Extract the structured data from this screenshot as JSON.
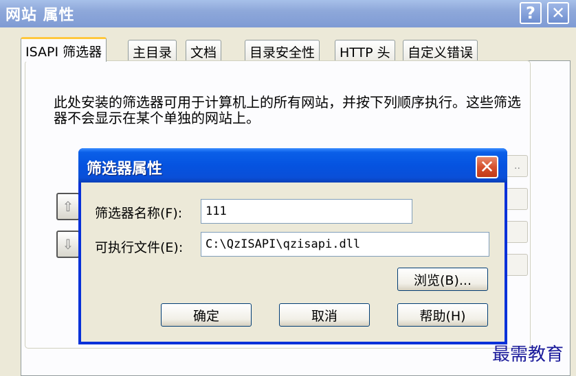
{
  "outer_window": {
    "title": "网站 属性",
    "help_label": "?",
    "close_label": "✕"
  },
  "tabs": [
    {
      "label": "ISAPI 筛选器"
    },
    {
      "label": "主目录"
    },
    {
      "label": "文档"
    },
    {
      "label": "目录安全性"
    },
    {
      "label": "HTTP 头"
    },
    {
      "label": "自定义错误"
    }
  ],
  "description": "此处安装的筛选器可用于计算机上的所有网站，并按下列顺序执行。这些筛选器不会显示在某个单独的网站上。",
  "side_buttons": {
    "up_glyph": "⇧",
    "down_glyph": "⇩"
  },
  "right_stub": {
    "ellipsis": ".."
  },
  "dialog": {
    "title": "筛选器属性",
    "close_label": "✕",
    "filter_name_label": "筛选器名称(F):",
    "filter_name_value": "111",
    "executable_label": "可执行文件(E):",
    "executable_value": "C:\\QzISAPI\\qzisapi.dll",
    "browse_label": "浏览(B)...",
    "ok_label": "确定",
    "cancel_label": "取消",
    "help_label": "帮助(H)"
  },
  "watermark": "最需教育"
}
